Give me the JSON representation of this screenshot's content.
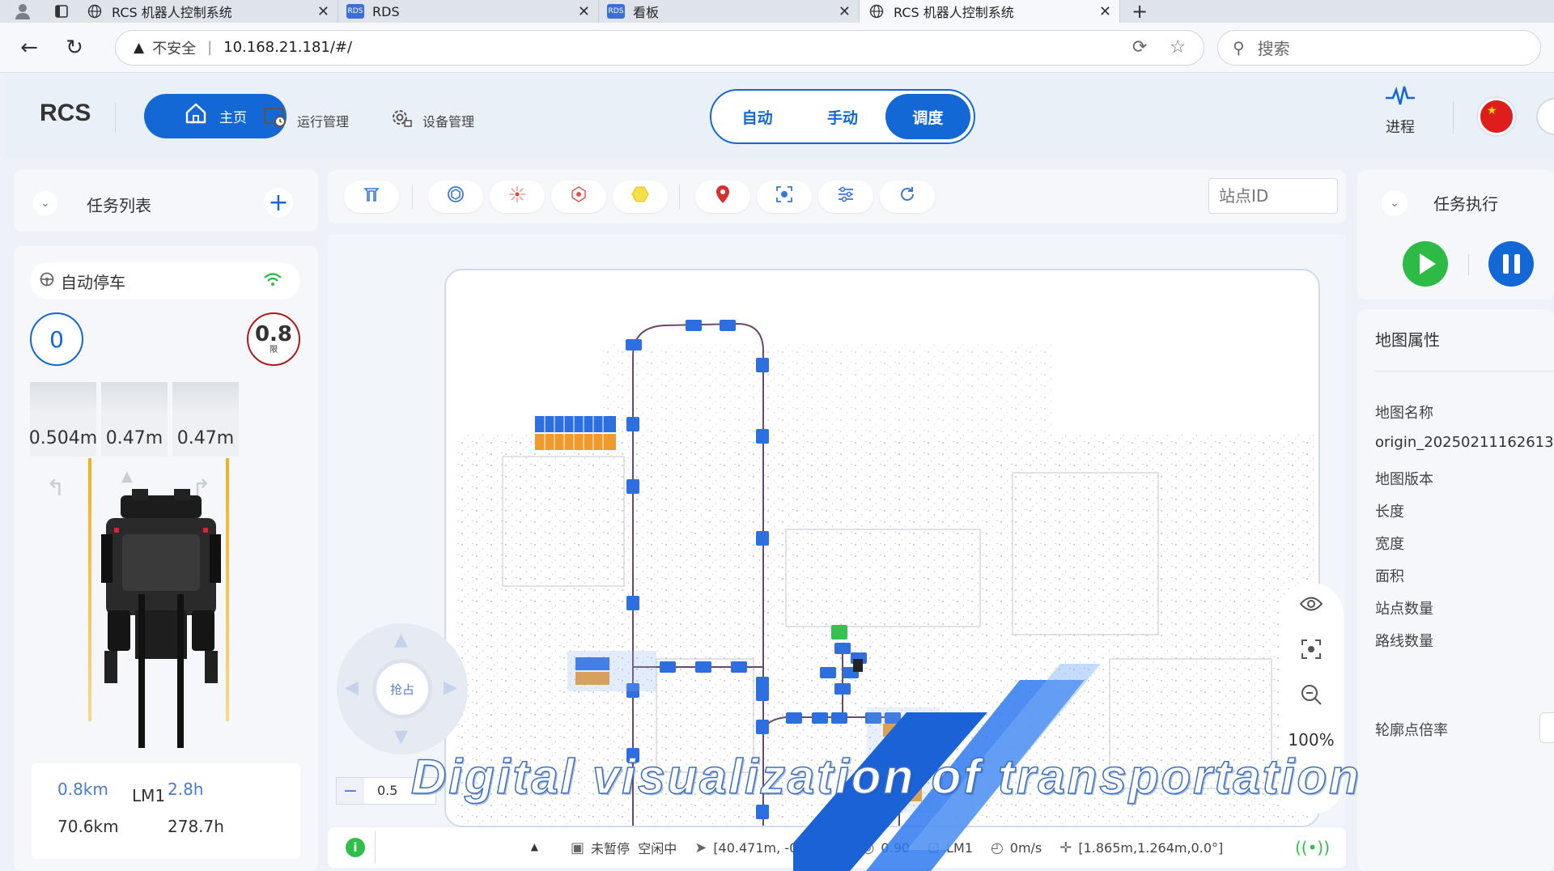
{
  "browser": {
    "tabs": [
      {
        "label": "RCS 机器人控制系统",
        "icon": "globe-icon",
        "active": false
      },
      {
        "label": "RDS",
        "icon": "rds-icon",
        "active": false
      },
      {
        "label": "看板",
        "icon": "rds-icon",
        "active": false
      },
      {
        "label": "RCS 机器人控制系统",
        "icon": "globe-icon",
        "active": true
      }
    ],
    "tab_icon_text": "RDS",
    "insecure_label": "不安全",
    "url": "10.168.21.181/#/",
    "search_placeholder": "搜索"
  },
  "header": {
    "logo": "RCS",
    "home_label": "主页",
    "nav": [
      {
        "label": "运行管理",
        "icon": "operation-icon"
      },
      {
        "label": "设备管理",
        "icon": "device-settings-icon"
      }
    ],
    "modes": [
      {
        "label": "自动",
        "active": false
      },
      {
        "label": "手动",
        "active": false
      },
      {
        "label": "调度",
        "active": true
      }
    ],
    "progress_label": "进程",
    "accent": "#1468d6"
  },
  "task_list": {
    "title": "任务列表"
  },
  "vehicle": {
    "status": "自动停车",
    "speed": "0",
    "speed_limit": "0.8",
    "speed_limit_sub": "限",
    "sensors": [
      "0.504m",
      "0.47m",
      "0.47m"
    ],
    "odometer": {
      "top_left": "0.8km",
      "map": "LM1",
      "top_right": "2.8h",
      "bottom_left": "70.6km",
      "bottom_right": "278.7h"
    }
  },
  "toolbar": {
    "buttons": [
      "cone-icon",
      "badge-icon",
      "network-icon",
      "hub-icon",
      "hexagon-icon",
      "location-pin-icon",
      "focus-icon",
      "sliders-icon",
      "refresh-icon"
    ],
    "station_placeholder": "站点ID"
  },
  "map": {
    "joystick_label": "抢占",
    "zoom": "100%",
    "scale_value": "0.5"
  },
  "status_bar": {
    "pause_state": "未暂停",
    "idle_state": "空闲中",
    "position": "[40.471m,  -0.483m]",
    "confidence": "0.90",
    "map": "LM1",
    "velocity": "0m/s",
    "pose": "[1.865m,1.264m,0.0°]"
  },
  "task_exec": {
    "title": "任务执行"
  },
  "map_attr": {
    "title": "地图属性",
    "fields": [
      {
        "label": "地图名称"
      },
      {
        "value": "origin_20250211162613"
      },
      {
        "label": "地图版本"
      },
      {
        "label": "长度"
      },
      {
        "label": "宽度"
      },
      {
        "label": "面积"
      },
      {
        "label": "站点数量"
      },
      {
        "label": "路线数量"
      },
      {
        "label": "轮廓点倍率"
      }
    ]
  },
  "overlay": {
    "caption": "Digital visualization of transportation"
  }
}
